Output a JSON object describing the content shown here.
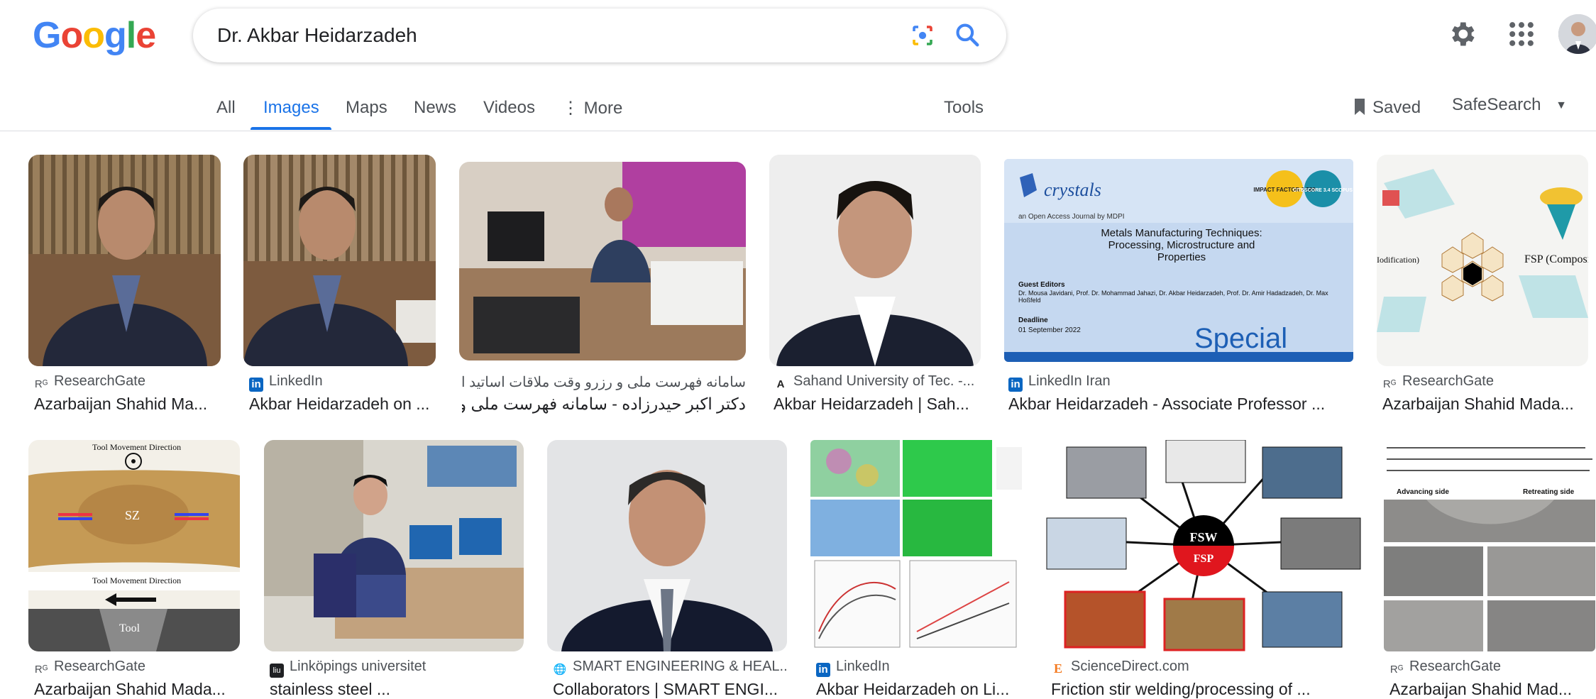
{
  "logo_text": "Google",
  "search": {
    "query": "Dr. Akbar Heidarzadeh"
  },
  "tabs": [
    {
      "label": "All"
    },
    {
      "label": "Images"
    },
    {
      "label": "Maps"
    },
    {
      "label": "News"
    },
    {
      "label": "Videos"
    },
    {
      "label": "More"
    },
    {
      "label": "Tools"
    }
  ],
  "header": {
    "saved": "Saved",
    "safesearch": "SafeSearch"
  },
  "results_row1": [
    {
      "source": "ResearchGate",
      "title": "Azarbaijan Shahid Ma...",
      "icon": "researchgate-icon"
    },
    {
      "source": "LinkedIn",
      "title": "Akbar Heidarzadeh on ...",
      "icon": "linkedin-icon"
    },
    {
      "source": "سامانه فهرست ملی و رزرو وقت ملاقات اساتید ایران",
      "title": "دکتر اکبر حیدرزاده - سامانه فهرست ملی و ...",
      "icon": "person-icon"
    },
    {
      "source": "Sahand University of Tec. -...",
      "title": "Akbar Heidarzadeh | Sah...",
      "icon": "academia-icon"
    },
    {
      "source": "LinkedIn Iran",
      "title": "Akbar Heidarzadeh - Associate Professor ...",
      "icon": "linkedin-icon"
    },
    {
      "source": "ResearchGate",
      "title": "Azarbaijan Shahid Mada...",
      "icon": "researchgate-icon"
    }
  ],
  "results_row2": [
    {
      "source": "ResearchGate",
      "title": "Azarbaijan Shahid Mada...",
      "icon": "researchgate-icon"
    },
    {
      "source": "Linköpings universitet",
      "title": "stainless steel ...",
      "icon": "liu-icon"
    },
    {
      "source": "SMART ENGINEERING & HEAL...",
      "title": "Collaborators | SMART ENGI...",
      "icon": "globe-icon"
    },
    {
      "source": "LinkedIn",
      "title": "Akbar Heidarzadeh on Li...",
      "icon": "linkedin-icon"
    },
    {
      "source": "ScienceDirect.com",
      "title": "Friction stir welding/processing of ...",
      "icon": "elsevier-icon"
    },
    {
      "source": "ResearchGate",
      "title": "Azarbaijan Shahid Mad...",
      "icon": "researchgate-icon"
    }
  ],
  "thumb_text": {
    "crystals_brand": "crystals",
    "crystals_sub": "an Open Access Journal by MDPI",
    "crystals_title": "Metals Manufacturing Techniques: Processing, Microstructure and Properties",
    "crystals_editors_label": "Guest Editors",
    "crystals_editors": "Dr. Mousa Javidani, Prof. Dr. Mohammad Jahazi, Dr. Akbar Heidarzadeh, Prof. Dr. Amir Hadadzadeh, Dr. Max Hoßfeld",
    "crystals_deadline_label": "Deadline",
    "crystals_deadline": "01 September 2022",
    "crystals_impact": "IMPACT FACTOR 2.589",
    "crystals_citescore": "CITESCORE 3.4 SCOPUS",
    "crystals_special": "Special",
    "fsw_center": "FSW",
    "fsp_center": "FSP",
    "tool_dir": "Tool Movement Direction",
    "sz_label": "SZ",
    "tool_label": "Tool",
    "fsp_composite": "FSP (Composite Pro",
    "modification": "Iodification)",
    "advancing": "Advancing side",
    "retreating": "Retreating side"
  },
  "colors": {
    "accent": "#1a73e8",
    "text": "#202124",
    "muted": "#4d5156"
  }
}
